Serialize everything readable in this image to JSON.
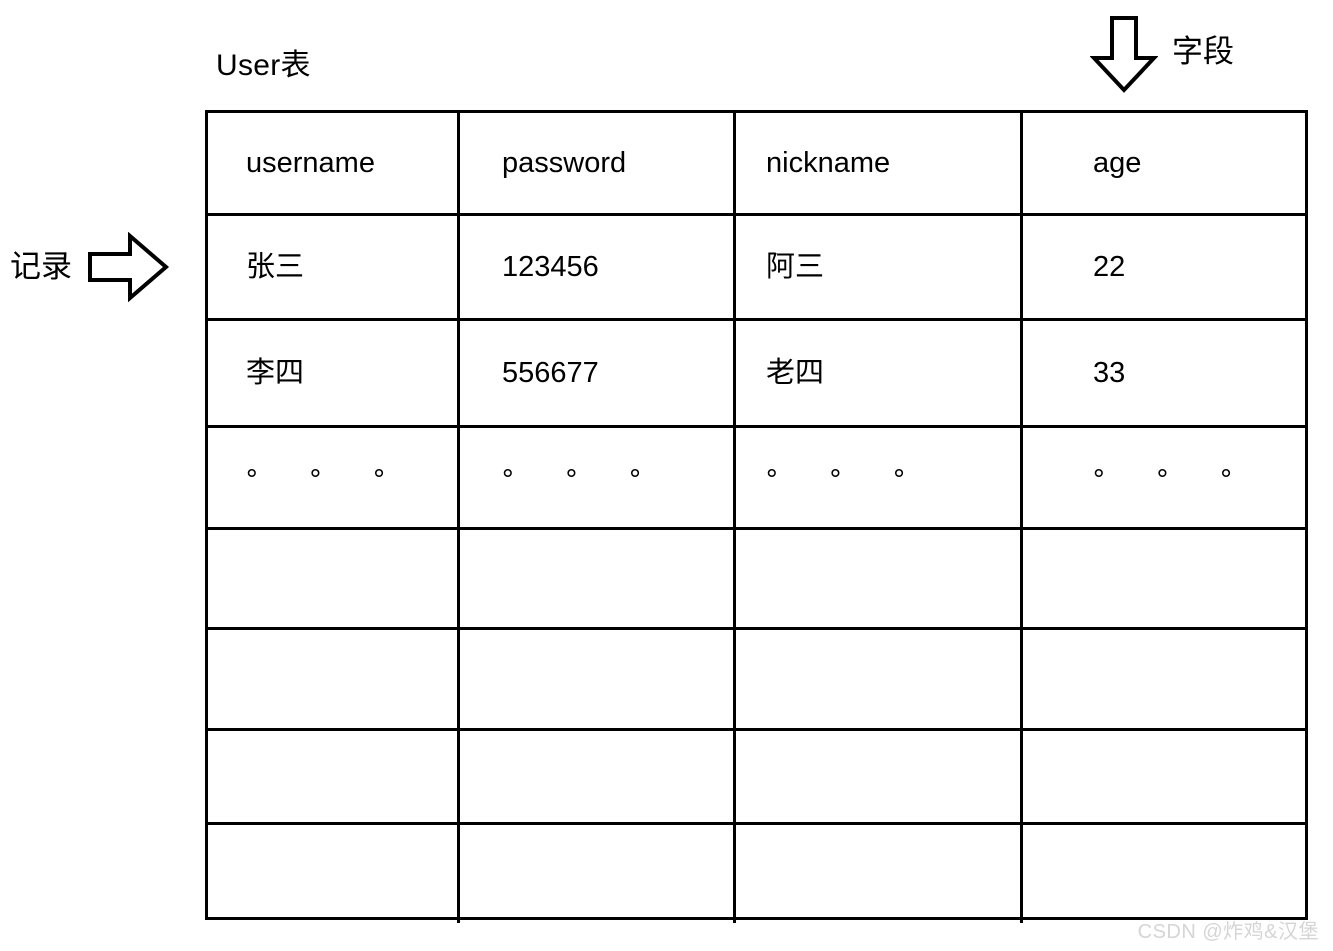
{
  "diagram": {
    "title": "User表",
    "watermark": "CSDN @炸鸡&汉堡",
    "annotations": {
      "field": {
        "label": "字段",
        "icon": "arrow-down-icon"
      },
      "record": {
        "label": "记录",
        "icon": "arrow-right-icon"
      }
    },
    "colors": {
      "line": "#000000",
      "text": "#000000",
      "background": "#ffffff",
      "watermark": "#d5d5d5"
    }
  },
  "table": {
    "name": "User表",
    "columns": [
      "username",
      "password",
      "nickname",
      "age"
    ],
    "rows": [
      [
        "张三",
        "123456",
        "阿三",
        "22"
      ],
      [
        "李四",
        "556677",
        "老四",
        "33"
      ],
      [
        "° ° °",
        "° ° °",
        "° ° °",
        "° ° °"
      ],
      [
        "",
        "",
        "",
        ""
      ],
      [
        "",
        "",
        "",
        ""
      ],
      [
        "",
        "",
        "",
        ""
      ],
      [
        "",
        "",
        "",
        ""
      ]
    ]
  }
}
